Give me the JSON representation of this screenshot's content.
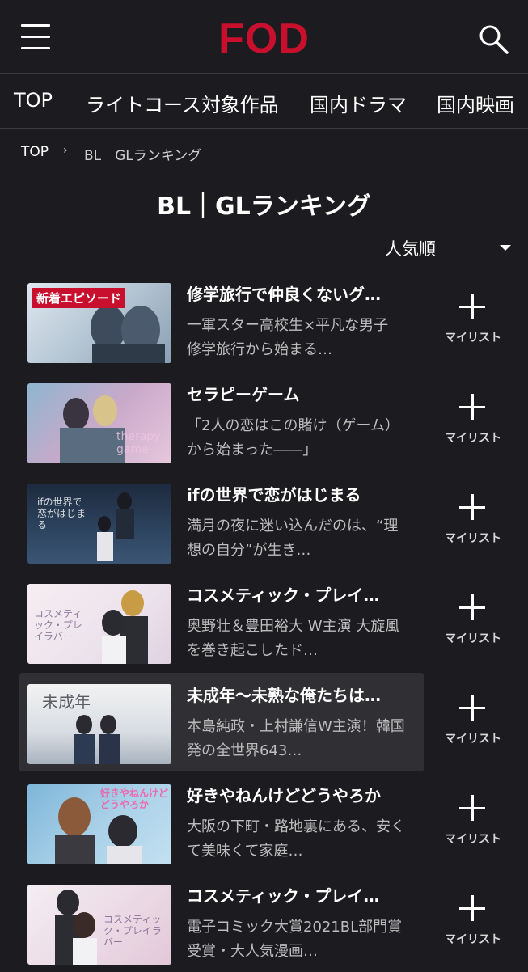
{
  "header": {
    "logo": "FOD"
  },
  "nav": {
    "items": [
      "TOP",
      "ライトコース対象作品",
      "国内ドラマ",
      "国内映画"
    ]
  },
  "breadcrumb": {
    "home": "TOP",
    "current": "BL｜GLランキング"
  },
  "page": {
    "title": "BL｜GLランキング"
  },
  "sort": {
    "label": "人気順"
  },
  "mylist_label": "マイリスト",
  "items": [
    {
      "title": "修学旅行で仲良くないグ…",
      "desc": "一軍スター高校生×平凡な男子 修学旅行から始まる…",
      "badge": "新着エピソード",
      "thumb_text": ""
    },
    {
      "title": "セラピーゲーム",
      "desc": "「2人の恋はこの賭け（ゲーム）から始まった――」",
      "badge": "",
      "thumb_text": "therapy game"
    },
    {
      "title": "ifの世界で恋がはじまる",
      "desc": "満月の夜に迷い込んだのは、“理想の自分”が生き…",
      "badge": "",
      "thumb_text": "ifの世界で恋がはじまる"
    },
    {
      "title": "コスメティック・プレイ…",
      "desc": "奥野壮＆豊田裕大 W主演 大旋風を巻き起こしたド…",
      "badge": "",
      "thumb_text": "コスメティック・プレイラバー"
    },
    {
      "title": "未成年〜未熟な俺たちは…",
      "desc": "本島純政・上村謙信W主演！韓国発の全世界643…",
      "badge": "",
      "thumb_text": "未成年"
    },
    {
      "title": "好きやねんけどどうやろか",
      "desc": "大阪の下町・路地裏にある、安くて美味くて家庭…",
      "badge": "",
      "thumb_text": "好きやねんけどどうやろか"
    },
    {
      "title": "コスメティック・プレイ…",
      "desc": "電子コミック大賞2021BL部門賞受賞・大人気漫画…",
      "badge": "",
      "thumb_text": "コスメティック・プレイラバー"
    }
  ],
  "colors": {
    "background": "#1c1c20",
    "brand": "#c8102e",
    "highlight": "#2f2f34"
  }
}
